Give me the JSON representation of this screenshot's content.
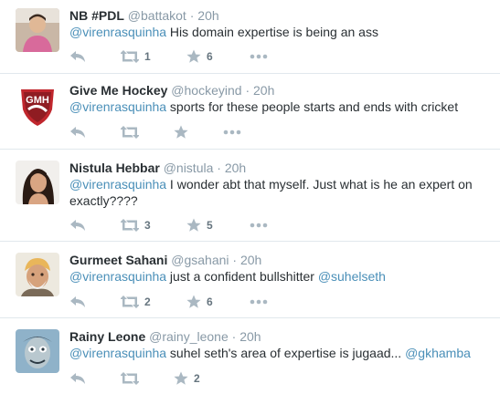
{
  "colors": {
    "mention": "#4a8fb8",
    "muted": "#8899a6",
    "icon": "#aab8c2",
    "divider": "#e1e8ed"
  },
  "icons": {
    "reply": "reply-icon",
    "retweet": "retweet-icon",
    "favorite": "star-icon",
    "more": "more-icon"
  },
  "tweets": [
    {
      "fullname": "NB #PDL",
      "handle": "@battakot",
      "sep": "·",
      "time": "20h",
      "mention": "@virenrasquinha",
      "text": " His domain expertise is being an ass",
      "mention2": "",
      "retweets": "1",
      "favorites": "6"
    },
    {
      "fullname": "Give Me Hockey",
      "handle": "@hockeyind",
      "sep": "·",
      "time": "20h",
      "mention": "@virenrasquinha",
      "text": " sports for these people starts and ends with cricket",
      "mention2": "",
      "retweets": "",
      "favorites": "",
      "avatar_text": "GMH"
    },
    {
      "fullname": "Nistula Hebbar",
      "handle": "@nistula",
      "sep": "·",
      "time": "20h",
      "mention": "@virenrasquinha",
      "text": " I wonder abt that myself. Just what is he an expert on exactly????",
      "mention2": "",
      "retweets": "3",
      "favorites": "5"
    },
    {
      "fullname": "Gurmeet Sahani",
      "handle": "@gsahani",
      "sep": "·",
      "time": "20h",
      "mention": "@virenrasquinha",
      "text": " just a confident bullshitter ",
      "mention2": "@suhelseth",
      "retweets": "2",
      "favorites": "6"
    },
    {
      "fullname": "Rainy Leone",
      "handle": "@rainy_leone",
      "sep": "·",
      "time": "20h",
      "mention": "@virenrasquinha",
      "text": " suhel seth's area of expertise is jugaad... ",
      "mention2": "@gkhamba",
      "retweets": "",
      "favorites": "2"
    }
  ]
}
